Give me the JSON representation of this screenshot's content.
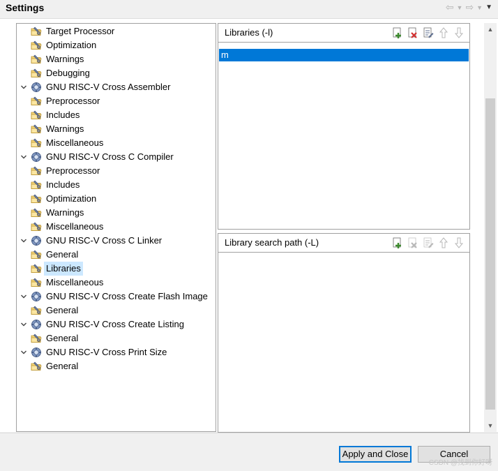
{
  "window": {
    "title": "Settings"
  },
  "tree": {
    "items": [
      {
        "label": "Target Processor",
        "level": 2,
        "expanded": null,
        "icon": "folder-settings-icon",
        "selected": false
      },
      {
        "label": "Optimization",
        "level": 2,
        "expanded": null,
        "icon": "folder-settings-icon",
        "selected": false
      },
      {
        "label": "Warnings",
        "level": 2,
        "expanded": null,
        "icon": "folder-settings-icon",
        "selected": false
      },
      {
        "label": "Debugging",
        "level": 2,
        "expanded": null,
        "icon": "folder-settings-icon",
        "selected": false
      },
      {
        "label": "GNU RISC-V Cross Assembler",
        "level": 1,
        "expanded": true,
        "icon": "tool-gear-icon",
        "selected": false
      },
      {
        "label": "Preprocessor",
        "level": 2,
        "expanded": null,
        "icon": "folder-settings-icon",
        "selected": false
      },
      {
        "label": "Includes",
        "level": 2,
        "expanded": null,
        "icon": "folder-settings-icon",
        "selected": false
      },
      {
        "label": "Warnings",
        "level": 2,
        "expanded": null,
        "icon": "folder-settings-icon",
        "selected": false
      },
      {
        "label": "Miscellaneous",
        "level": 2,
        "expanded": null,
        "icon": "folder-settings-icon",
        "selected": false
      },
      {
        "label": "GNU RISC-V Cross C Compiler",
        "level": 1,
        "expanded": true,
        "icon": "tool-gear-icon",
        "selected": false
      },
      {
        "label": "Preprocessor",
        "level": 2,
        "expanded": null,
        "icon": "folder-settings-icon",
        "selected": false
      },
      {
        "label": "Includes",
        "level": 2,
        "expanded": null,
        "icon": "folder-settings-icon",
        "selected": false
      },
      {
        "label": "Optimization",
        "level": 2,
        "expanded": null,
        "icon": "folder-settings-icon",
        "selected": false
      },
      {
        "label": "Warnings",
        "level": 2,
        "expanded": null,
        "icon": "folder-settings-icon",
        "selected": false
      },
      {
        "label": "Miscellaneous",
        "level": 2,
        "expanded": null,
        "icon": "folder-settings-icon",
        "selected": false
      },
      {
        "label": "GNU RISC-V Cross C Linker",
        "level": 1,
        "expanded": true,
        "icon": "tool-gear-icon",
        "selected": false
      },
      {
        "label": "General",
        "level": 2,
        "expanded": null,
        "icon": "folder-settings-icon",
        "selected": false
      },
      {
        "label": "Libraries",
        "level": 2,
        "expanded": null,
        "icon": "folder-settings-icon",
        "selected": true
      },
      {
        "label": "Miscellaneous",
        "level": 2,
        "expanded": null,
        "icon": "folder-settings-icon",
        "selected": false
      },
      {
        "label": "GNU RISC-V Cross Create Flash Image",
        "level": 1,
        "expanded": true,
        "icon": "tool-gear-icon",
        "selected": false
      },
      {
        "label": "General",
        "level": 2,
        "expanded": null,
        "icon": "folder-settings-icon",
        "selected": false
      },
      {
        "label": "GNU RISC-V Cross Create Listing",
        "level": 1,
        "expanded": true,
        "icon": "tool-gear-icon",
        "selected": false
      },
      {
        "label": "General",
        "level": 2,
        "expanded": null,
        "icon": "folder-settings-icon",
        "selected": false
      },
      {
        "label": "GNU RISC-V Cross Print Size",
        "level": 1,
        "expanded": true,
        "icon": "tool-gear-icon",
        "selected": false
      },
      {
        "label": "General",
        "level": 2,
        "expanded": null,
        "icon": "folder-settings-icon",
        "selected": false
      }
    ]
  },
  "libraries_pane": {
    "title": "Libraries (-l)",
    "tools": [
      "add-icon",
      "delete-icon",
      "edit-icon",
      "move-up-icon",
      "move-down-icon"
    ],
    "items": [
      {
        "value": "m",
        "selected": true
      }
    ]
  },
  "search_path_pane": {
    "title": "Library search path (-L)",
    "tools": [
      "add-icon",
      "delete-icon",
      "edit-icon",
      "move-up-icon",
      "move-down-icon"
    ],
    "items": []
  },
  "buttons": {
    "apply_close": "Apply and Close",
    "cancel": "Cancel"
  },
  "watermark": "CSDN @找到你好呀",
  "colors": {
    "selection": "#0078d7",
    "tree_selection": "#cce8ff"
  }
}
